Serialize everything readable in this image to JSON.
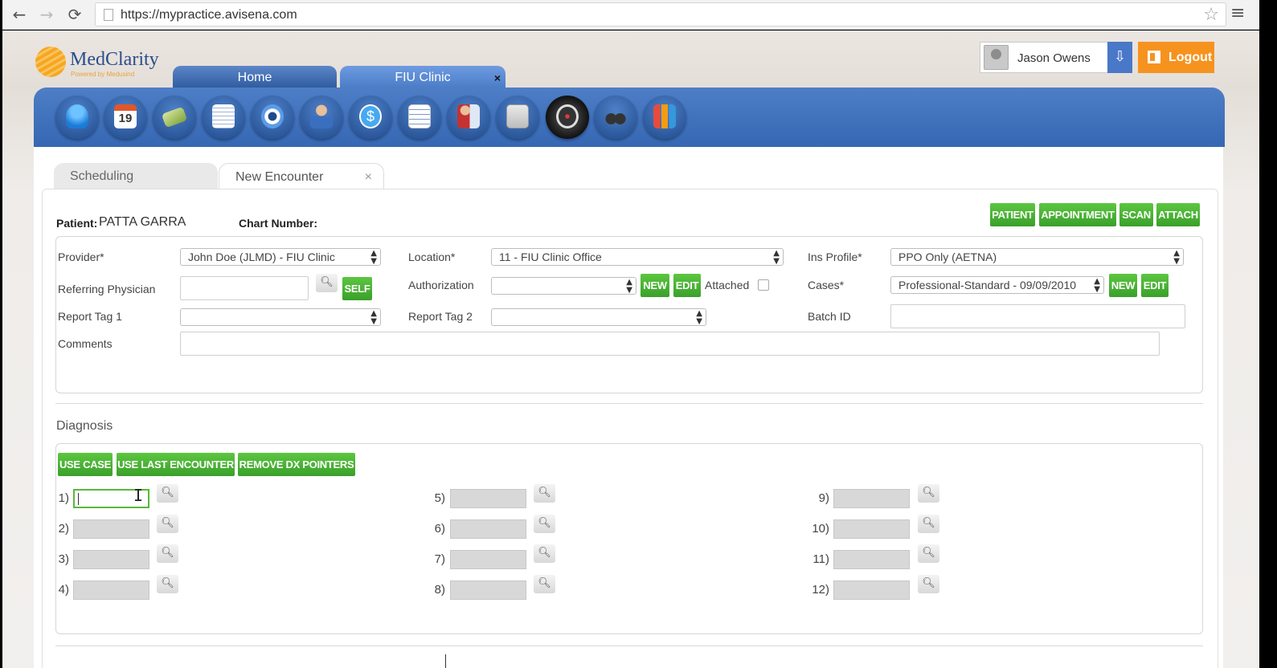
{
  "browser": {
    "url": "https://mypractice.avisena.com"
  },
  "app": {
    "logo": {
      "name": "MedClarity",
      "tagline": "Powered by Medusind"
    },
    "tabs": [
      {
        "label": "Home"
      },
      {
        "label": "FIU Clinic",
        "close": "×"
      }
    ],
    "user": {
      "name": "Jason Owens"
    },
    "logout_label": "Logout",
    "toolbar_icons": [
      "patients-icon",
      "calendar-icon",
      "billing-icon",
      "documents-icon",
      "settings-icon",
      "provider-icon",
      "payments-icon",
      "reports-icon",
      "staff-icon",
      "files-icon",
      "dashboard-icon",
      "search-binoculars-icon",
      "charts-icon"
    ],
    "calendar_day": "19"
  },
  "subtabs": [
    {
      "label": "Scheduling"
    },
    {
      "label": "New Encounter",
      "close": "×"
    }
  ],
  "encounter": {
    "patient_label": "Patient:",
    "patient_name": "PATTA GARRA",
    "chart_label": "Chart Number:",
    "actions": [
      "PATIENT",
      "APPOINTMENT",
      "SCAN",
      "ATTACH"
    ],
    "fields": {
      "provider": {
        "label": "Provider*",
        "value": "John Doe (JLMD) - FIU Clinic"
      },
      "location": {
        "label": "Location*",
        "value": "11 - FIU Clinic Office"
      },
      "ins_profile": {
        "label": "Ins Profile*",
        "value": "PPO Only (AETNA)"
      },
      "referring": {
        "label": "Referring Physician",
        "self_label": "SELF"
      },
      "authorization": {
        "label": "Authorization",
        "new_label": "NEW",
        "edit_label": "EDIT",
        "attached_label": "Attached"
      },
      "cases": {
        "label": "Cases*",
        "value": "Professional-Standard - 09/09/2010",
        "new_label": "NEW",
        "edit_label": "EDIT"
      },
      "report_tag_1": {
        "label": "Report Tag 1"
      },
      "report_tag_2": {
        "label": "Report Tag 2"
      },
      "batch_id": {
        "label": "Batch ID"
      },
      "comments": {
        "label": "Comments"
      }
    }
  },
  "diagnosis": {
    "title": "Diagnosis",
    "buttons": [
      "USE CASE",
      "USE LAST ENCOUNTER",
      "REMOVE DX POINTERS"
    ],
    "rows": [
      "1)",
      "2)",
      "3)",
      "4)",
      "5)",
      "6)",
      "7)",
      "8)",
      "9)",
      "10)",
      "11)",
      "12)"
    ]
  }
}
